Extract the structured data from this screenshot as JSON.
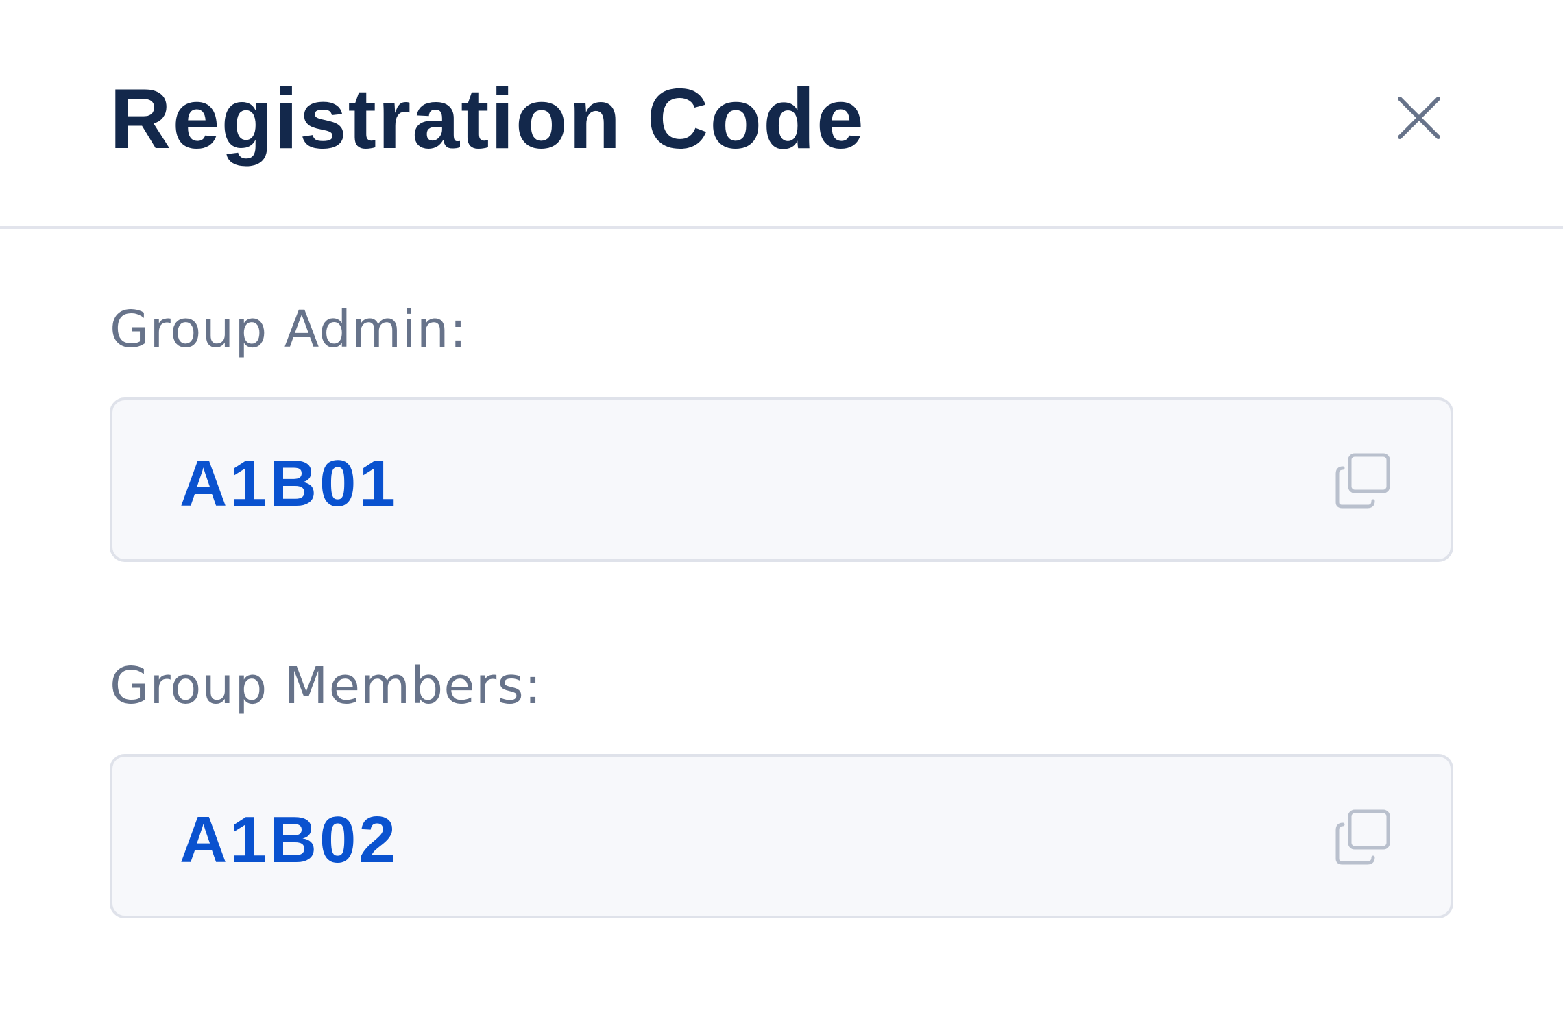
{
  "dialog": {
    "title": "Registration Code",
    "close_icon": "close-icon"
  },
  "fields": [
    {
      "label": "Group Admin:",
      "code": "A1B01",
      "copy_icon": "copy-icon"
    },
    {
      "label": "Group Members:",
      "code": "A1B02",
      "copy_icon": "copy-icon"
    }
  ],
  "colors": {
    "title": "#13284b",
    "label": "#67738a",
    "code": "#0a52cf",
    "field_background": "#f7f8fb",
    "field_border": "#dfe2ea",
    "divider": "#e2e4ec",
    "icon": "#67738a",
    "copy_icon": "#b9c0cd"
  }
}
